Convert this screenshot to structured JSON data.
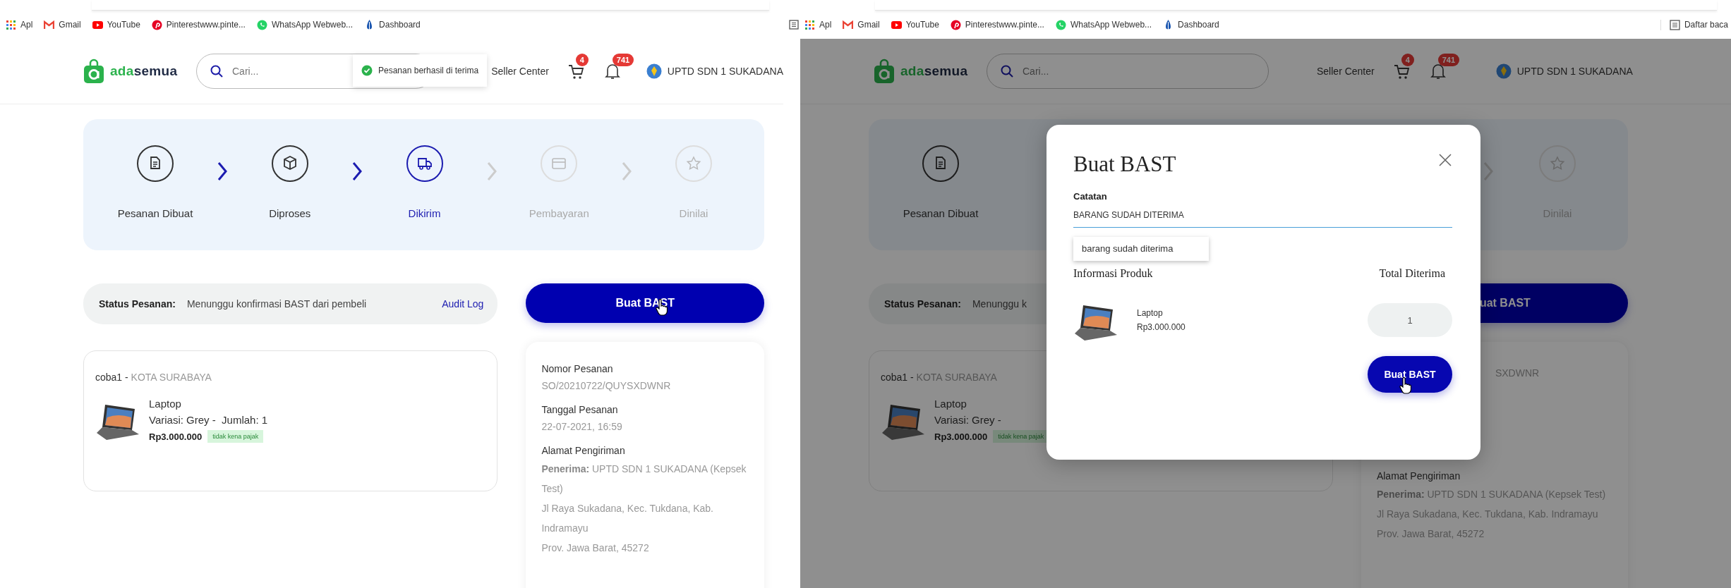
{
  "left_window": {
    "bookmarks": [
      {
        "label": "Apl"
      },
      {
        "label": "Gmail"
      },
      {
        "label": "YouTube"
      },
      {
        "label": "Pinterestwww.pinte..."
      },
      {
        "label": "WhatsApp Webweb..."
      },
      {
        "label": "Dashboard"
      }
    ],
    "header": {
      "logo_prefix": "ada",
      "logo_suffix": "semua",
      "search_placeholder": "Cari...",
      "toast": "Pesanan berhasil di terima",
      "seller_center": "Seller Center",
      "cart_count": "4",
      "notification_count": "741",
      "account": "UPTD SDN 1 SUKADANA"
    },
    "steps": [
      {
        "label": "Pesanan Dibuat",
        "kind": "document",
        "done": true,
        "current": false
      },
      {
        "label": "Diproses",
        "kind": "box",
        "done": true,
        "current": false
      },
      {
        "label": "Dikirim",
        "kind": "truck",
        "done": false,
        "current": true
      },
      {
        "label": "Pembayaran",
        "kind": "card",
        "done": false,
        "current": false
      },
      {
        "label": "Dinilai",
        "kind": "star",
        "done": false,
        "current": false
      }
    ],
    "status": {
      "label": "Status Pesanan:",
      "value": "Menunggu konfirmasi BAST dari pembeli",
      "link": "Audit Log"
    },
    "action_button": {
      "label": "Buat BAST",
      "hovered": true,
      "clipped": false
    },
    "order": {
      "seller": "coba1 -",
      "city": "KOTA SURABAYA",
      "product": "Laptop",
      "variant": "Variasi: Grey -  Jumlah: 1",
      "price": "Rp3.000.000",
      "tax_tag": "tidak kena pajak"
    },
    "details": [
      {
        "kind": "field",
        "label": "Nomor Pesanan",
        "value": "SO/20210722/QUYSXDWNR"
      },
      {
        "kind": "field",
        "label": "Tanggal Pesanan",
        "value": "22-07-2021, 16:59"
      },
      {
        "kind": "address",
        "label": "Alamat Pengiriman",
        "lines": [
          "**Penerima:** UPTD SDN 1 SUKADANA (Kepsek Test)",
          "Jl Raya Sukadana, Kec. Tukdana, Kab. Indramayu",
          "Prov. Jawa Barat, 45272"
        ]
      }
    ]
  },
  "right_window": {
    "leading_icon": true,
    "bookmarks": [
      {
        "label": "Apl"
      },
      {
        "label": "Gmail"
      },
      {
        "label": "YouTube"
      },
      {
        "label": "Pinterestwww.pinte..."
      },
      {
        "label": "WhatsApp Webweb..."
      },
      {
        "label": "Dashboard"
      }
    ],
    "reading_list": "Daftar baca",
    "header": {
      "logo_prefix": "ada",
      "logo_suffix": "semua",
      "search_placeholder": "Cari...",
      "seller_center": "Seller Center",
      "cart_count": "4",
      "notification_count": "741",
      "account": "UPTD SDN 1 SUKADANA"
    },
    "steps": [
      {
        "label": "Pesanan Dibuat",
        "kind": "document",
        "done": true,
        "current": false
      },
      {
        "label": "Dinilai",
        "kind": "star",
        "done": false,
        "current": false
      }
    ],
    "status": {
      "label": "Status Pesanan:",
      "value": "Menunggu k"
    },
    "action_button": {
      "label": "uat BAST",
      "hovered": false,
      "clipped": true
    },
    "order": {
      "seller": "coba1 -",
      "city": "KOTA SURABAYA",
      "product": "Laptop",
      "variant": "Variasi: Grey -",
      "price": "Rp3.000.000",
      "tax_tag": "tidak kena pajak"
    },
    "details": [
      {
        "kind": "partial",
        "value": "SXDWNR"
      },
      {
        "kind": "address",
        "label": "Alamat Pengiriman",
        "lines": [
          "**Penerima:** UPTD SDN 1 SUKADANA (Kepsek Test)",
          "Jl Raya Sukadana, Kec. Tukdana, Kab. Indramayu",
          "Prov. Jawa Barat, 45272"
        ]
      }
    ],
    "modal": {
      "title": "Buat BAST",
      "note_label": "Catatan",
      "note_value": "BARANG SUDAH DITERIMA",
      "suggestion": "barang sudah diterima",
      "product_heading": "Informasi Produk",
      "total_heading": "Total Diterima",
      "items": [
        {
          "name": "Laptop",
          "price": "Rp3.000.000",
          "quantity": "1"
        }
      ],
      "submit": {
        "label": "Buat BAST",
        "hovered": true
      }
    }
  }
}
